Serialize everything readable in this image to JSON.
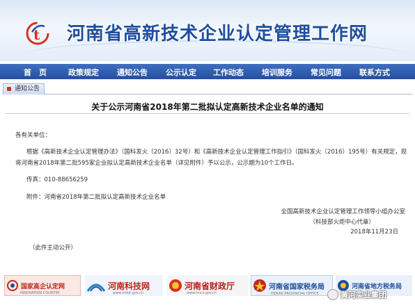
{
  "site": {
    "title": "河南省高新技术企业认定管理工作网"
  },
  "nav": {
    "items": [
      "首　页",
      "政策规定",
      "通知公告",
      "公示认定",
      "工作动态",
      "培训服务",
      "常见问题",
      "联系方式"
    ]
  },
  "breadcrumb": {
    "label": "通知公告"
  },
  "article": {
    "title": "关于公示河南省2018年第二批拟认定高新技术企业名单的通知",
    "greeting": "各有关单位：",
    "body_line1": "根据《高新技术企业认定管理办法》（国科发火〔2016〕32号）和《高新技术企业认定管理工作指引》（国科发火〔2016〕195号）有关规定，现",
    "body_line2": "将河南省2018年第二批595家企业拟认定高新技术企业名单（详见附件）予以公示，公示期为10个工作日。",
    "fax": "传真：010-88656259",
    "attachment": "附件：河南省2018年第二批拟认定高新技术企业名单",
    "signature1": "全国高新技术企业认定管理工作领导小组办公室",
    "signature2": "（科技部火炬中心代章）",
    "date": "2018年11月23日",
    "note": "（此件主动公开）"
  },
  "footer": {
    "logo1": "国家高企认定网",
    "logo1_sub": "INNOVATION COUNTRY",
    "logo2": "河南科技网",
    "logo2_sub": "www.hnkjt.gov.cn",
    "logo3": "河南省财政厅",
    "logo3_sub": "www.hncz.gov.cn",
    "logo4": "河南省国家税务局",
    "logo4_sub": "HENAN PROVINCIAL OFFICE",
    "logo5": "河南省地方税务局",
    "watermark": "黄河实业集团"
  },
  "colors": {
    "brand": "#1f4e9e",
    "nav": "#2b58a8",
    "accent": "#d9301c"
  }
}
